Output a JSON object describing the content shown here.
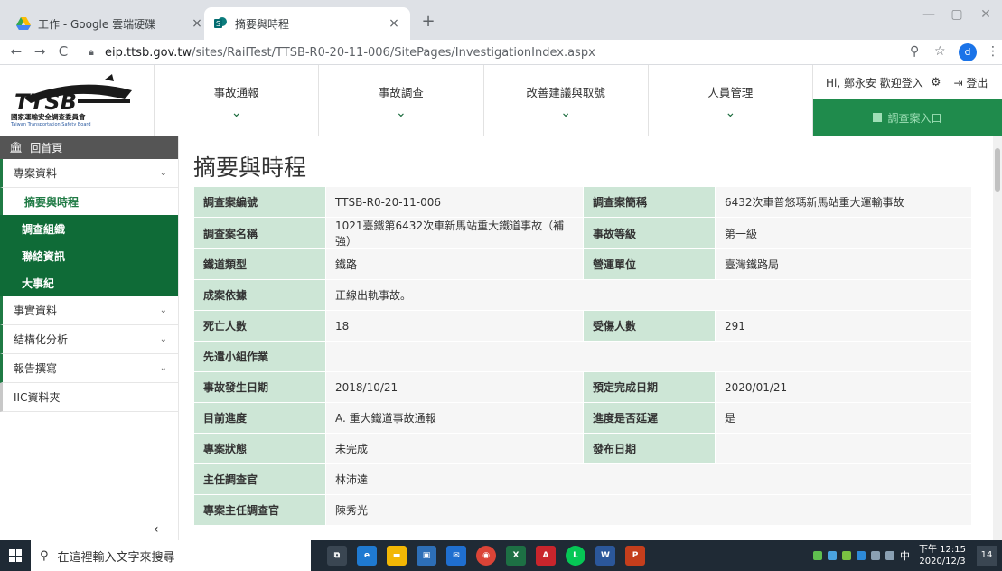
{
  "browser": {
    "tabs": [
      {
        "title": "工作 - Google 雲端硬碟",
        "close": "×"
      },
      {
        "title": "摘要與時程",
        "close": "×"
      }
    ],
    "new_tab": "+",
    "window_controls": {
      "minimize": "—",
      "maximize": "▢",
      "close": "✕"
    },
    "nav": {
      "back": "←",
      "forward": "→",
      "reload": "C"
    },
    "url_host": "eip.ttsb.gov.tw",
    "url_path": "/sites/RailTest/TTSB-R0-20-11-006/SitePages/InvestigationIndex.aspx",
    "profile_initial": "d"
  },
  "header": {
    "logo_text": "TTSB",
    "logo_subtitle_zh": "國家運輸安全調查委員會",
    "logo_subtitle_en": "Taiwan Transportation Safety Board",
    "nav": [
      {
        "label": "事故通報"
      },
      {
        "label": "事故調查"
      },
      {
        "label": "改善建議與取號"
      },
      {
        "label": "人員管理"
      }
    ],
    "chevron": "⌄",
    "greeting": "Hi, 鄭永安 歡迎登入",
    "logout_label": "登出",
    "entry_label": "調查案入口"
  },
  "sidebar": {
    "home_label": "回首頁",
    "sections": [
      {
        "label": "專案資料"
      },
      {
        "label": "事實資料"
      },
      {
        "label": "結構化分析"
      },
      {
        "label": "報告撰寫"
      },
      {
        "label": "IIC資料夾"
      }
    ],
    "sub_items": [
      {
        "label": "摘要與時程"
      },
      {
        "label": "調查組織"
      },
      {
        "label": "聯絡資訊"
      },
      {
        "label": "大事紀"
      }
    ],
    "collapse": "‹"
  },
  "main": {
    "page_title": "摘要與時程",
    "rows": [
      {
        "l1": "調查案編號",
        "v1": "TTSB-R0-20-11-006",
        "l2": "調查案簡稱",
        "v2": "6432次車普悠瑪新馬站重大運輸事故"
      },
      {
        "l1": "調查案名稱",
        "v1": "1021臺鐵第6432次車新馬站重大鐵道事故（補強）",
        "l2": "事故等級",
        "v2": "第一級"
      },
      {
        "l1": "鐵道類型",
        "v1": "鐵路",
        "l2": "營運單位",
        "v2": "臺灣鐵路局"
      },
      {
        "l1": "成案依據",
        "v1": "正線出軌事故。"
      },
      {
        "l1": "死亡人數",
        "v1": "18",
        "l2": "受傷人數",
        "v2": "291"
      },
      {
        "l1": "先遣小組作業",
        "v1": ""
      },
      {
        "l1": "事故發生日期",
        "v1": "2018/10/21",
        "l2": "預定完成日期",
        "v2": "2020/01/21"
      },
      {
        "l1": "目前進度",
        "v1": "A. 重大鐵道事故通報",
        "l2": "進度是否延遲",
        "v2": "是"
      },
      {
        "l1": "專案狀態",
        "v1": "未完成",
        "l2": "發布日期",
        "v2": ""
      },
      {
        "l1": "主任調查官",
        "v1": "林沛達"
      },
      {
        "l1": "專案主任調查官",
        "v1": "陳秀光"
      }
    ]
  },
  "taskbar": {
    "search_placeholder": "在這裡輸入文字來搜尋",
    "time": "下午 12:15",
    "date": "2020/12/3",
    "ime": "中",
    "notifications": "14"
  }
}
